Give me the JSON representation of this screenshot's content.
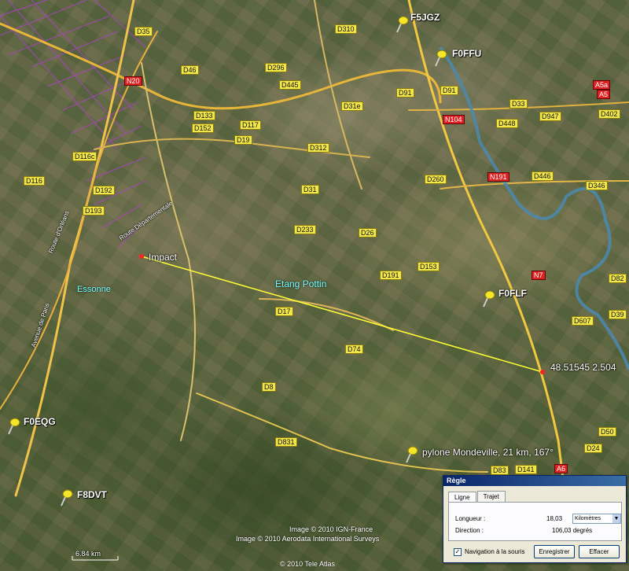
{
  "map": {
    "roads": {
      "D35": "D35",
      "D310": "D310",
      "D46": "D46",
      "D296": "D296",
      "N20": "N20",
      "D445": "D445",
      "D91_1": "D91",
      "D91_2": "D91",
      "D133": "D133",
      "D152": "D152",
      "D117": "D117",
      "D19": "D19",
      "D31e": "D31e",
      "D312": "D312",
      "N104": "N104",
      "D33": "D33",
      "D947": "D947",
      "D402": "D402",
      "D448": "D448",
      "A5a": "A5a",
      "A5": "A5",
      "D116c": "D116c",
      "D116": "D116",
      "D192": "D192",
      "D193": "D193",
      "D31": "D31",
      "D260": "D260",
      "N191": "N191",
      "D446": "D446",
      "D346": "D346",
      "D233": "D233",
      "D26": "D26",
      "D153": "D153",
      "D191": "D191",
      "N7": "N7",
      "D82": "D82",
      "D17": "D17",
      "D607": "D607",
      "D39": "D39",
      "D74": "D74",
      "D8": "D8",
      "D831": "D831",
      "D50": "D50",
      "D24": "D24",
      "D83": "D83",
      "D141": "D141",
      "A6": "A6"
    },
    "callsigns": {
      "f5jgz": "F5JGZ",
      "f0ffu": "F0FFU",
      "f0flf": "F0FLF",
      "f0eqg": "F0EQG",
      "f8dvt": "F8DVT"
    },
    "labels": {
      "impact": "Impact",
      "etang": "Etang Pottin",
      "essonne": "Essonne",
      "coords": "48.51545 2.504",
      "pylone": "pylone Mondeville, 21 km, 167°",
      "route_orleans": "Route d'Orléans",
      "route_dep": "Route Départementale",
      "route_dorleans2": "Avenue de Paris",
      "scale": "6.84 km"
    },
    "credits": {
      "ign": "Image © 2010 IGN-France",
      "aerodata": "Image © 2010 Aerodata International Surveys",
      "teleatlas": "© 2010 Tele Atlas"
    }
  },
  "ruler": {
    "title": "Règle",
    "tabs": [
      "Ligne",
      "Trajet"
    ],
    "length_label": "Longueur :",
    "length_value": "18,03",
    "unit": "Kilomètres",
    "direction_label": "Direction :",
    "direction_value": "106,03 degrés",
    "mouse_nav_label": "Navigation à la souris",
    "mouse_nav_checked": true,
    "save_button": "Enregistrer",
    "clear_button": "Effacer"
  },
  "colors": {
    "measure_line": "#ffff33",
    "road_shield": "#f1e64a",
    "river": "#4a8ab0",
    "restricted_zone": "#b040d0"
  }
}
